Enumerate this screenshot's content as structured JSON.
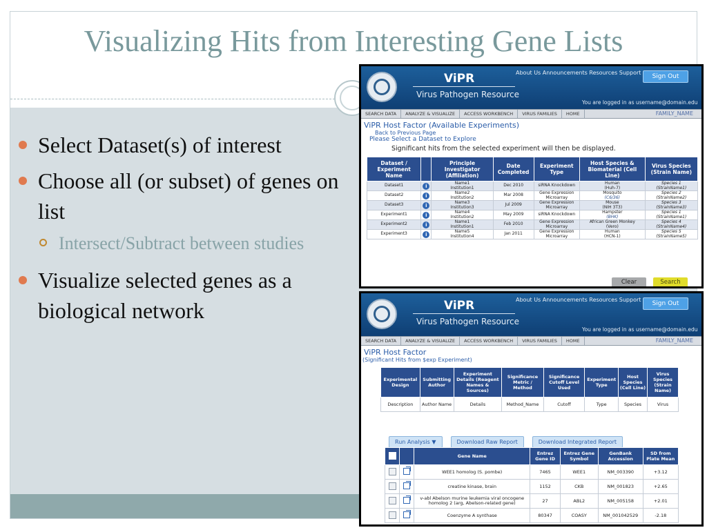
{
  "slide": {
    "title": "Visualizing Hits from Interesting Gene Lists",
    "bullets": [
      {
        "text": "Select Dataset(s) of interest"
      },
      {
        "text": "Choose all (or subset) of genes on list",
        "sub": "Intersect/Subtract between studies"
      },
      {
        "text": "Visualize selected genes as a biological network"
      }
    ],
    "colors": {
      "title": "#79999c",
      "bullet": "#e07a4f",
      "background": "#d6dee2",
      "footer": "#8fa9ab"
    }
  },
  "header": {
    "app_name": "ViPR",
    "subtitle": "Virus Pathogen Resource",
    "top_links": [
      "About Us",
      "Announcements",
      "Resources",
      "Support"
    ],
    "sign_out": "Sign Out",
    "logged_in": "You are logged in as username@domain.edu",
    "nav": [
      "SEARCH DATA",
      "ANALYZE & VISUALIZE",
      "ACCESS WORKBENCH",
      "VIRUS FAMILIES",
      "HOME"
    ],
    "family": "FAMILY_NAME"
  },
  "screen1": {
    "title": "ViPR Host Factor (Available Experiments)",
    "back_link": "Back to Previous Page",
    "select_prompt": "Please Select a Dataset to Explore",
    "note": "Significant hits from the selected experiment will then be displayed.",
    "columns": [
      "Dataset / Experiment Name",
      "",
      "Principle Investigator (Affiliation)",
      "Date Completed",
      "Experiment Type",
      "Host Species & Biomaterial (Cell Line)",
      "Virus Species (Strain Name)"
    ],
    "rows": [
      {
        "name": "Dataset1",
        "pi1": "Name1",
        "pi2": "Institution1",
        "date": "Dec 2010",
        "type": "siRNA Knockdown",
        "host1": "Human",
        "host2": "(Huh-7)",
        "virus1": "Species 1",
        "virus2": "(StrainName1)"
      },
      {
        "name": "Dataset2",
        "pi1": "Name2",
        "pi2": "Institution2",
        "date": "Mar 2008",
        "type": "Gene Expression Microarray",
        "host1": "Mosquito",
        "host2": "(C6/36)",
        "virus1": "Species 2",
        "virus2": "(StrainName2)"
      },
      {
        "name": "Dataset3",
        "pi1": "Name3",
        "pi2": "Institution3",
        "date": "Jul 2009",
        "type": "Gene Expression Microarray",
        "host1": "Mouse",
        "host2": "(NIH 3T3)",
        "virus1": "Species 3",
        "virus2": "(StrainName3)"
      },
      {
        "name": "Experiment1",
        "pi1": "Name4",
        "pi2": "Institution2",
        "date": "May 2009",
        "type": "siRNA Knockdown",
        "host1": "Hampster",
        "host2": "(BHK)",
        "virus1": "Species 1",
        "virus2": "(StrainName1)"
      },
      {
        "name": "Experiment2",
        "pi1": "Name1",
        "pi2": "Institution1",
        "date": "Feb 2010",
        "type": "Gene Expression Microarray",
        "host1": "African Green Monkey",
        "host2": "(Vero)",
        "virus1": "Species 4",
        "virus2": "(StrainName4)"
      },
      {
        "name": "Experiment3",
        "pi1": "Name5",
        "pi2": "Institution4",
        "date": "Jan 2011",
        "type": "Gene Expression Microarray",
        "host1": "Human",
        "host2": "(HCN-1)",
        "virus1": "Species 5",
        "virus2": "(StrainName5)"
      }
    ],
    "clear": "Clear",
    "search": "Search"
  },
  "screen2": {
    "title": "ViPR Host Factor",
    "subtitle": "(Significant Hits from $exp Experiment)",
    "design_columns": [
      "Experimental Design",
      "Submitting Author",
      "Experiment Details (Reagent Names & Sources)",
      "Significance Metric / Method",
      "Significance Cutoff Level Used",
      "Experiment Type",
      "Host Species (Cell Line)",
      "Virus Species (Strain Name)"
    ],
    "design_row": [
      "Description",
      "Author Name",
      "Details",
      "Method_Name",
      "Cutoff",
      "Type",
      "Species",
      "Virus"
    ],
    "run_analysis": "Run Analysis",
    "download_raw": "Download Raw Report",
    "download_integrated": "Download Integrated Report",
    "gene_columns": [
      "Gene Name",
      "Entrez Gene ID",
      "Entrez Gene Symbol",
      "GenBank Accession",
      "SD from Plate Mean"
    ],
    "genes": [
      {
        "name": "WEE1 homolog (S. pombe)",
        "id": "7465",
        "symbol": "WEE1",
        "acc": "NM_003390",
        "sd": "+3.12"
      },
      {
        "name": "creatine kinase, brain",
        "id": "1152",
        "symbol": "CKB",
        "acc": "NM_001823",
        "sd": "+2.65"
      },
      {
        "name": "v-abl Abelson murine leukemia viral oncogene homolog 2 (arg, Abelson-related gene)",
        "id": "27",
        "symbol": "ABL2",
        "acc": "NM_005158",
        "sd": "+2.01"
      },
      {
        "name": "Coenzyme A synthase",
        "id": "80347",
        "symbol": "COASY",
        "acc": "NM_001042529",
        "sd": "-2.18"
      }
    ]
  }
}
